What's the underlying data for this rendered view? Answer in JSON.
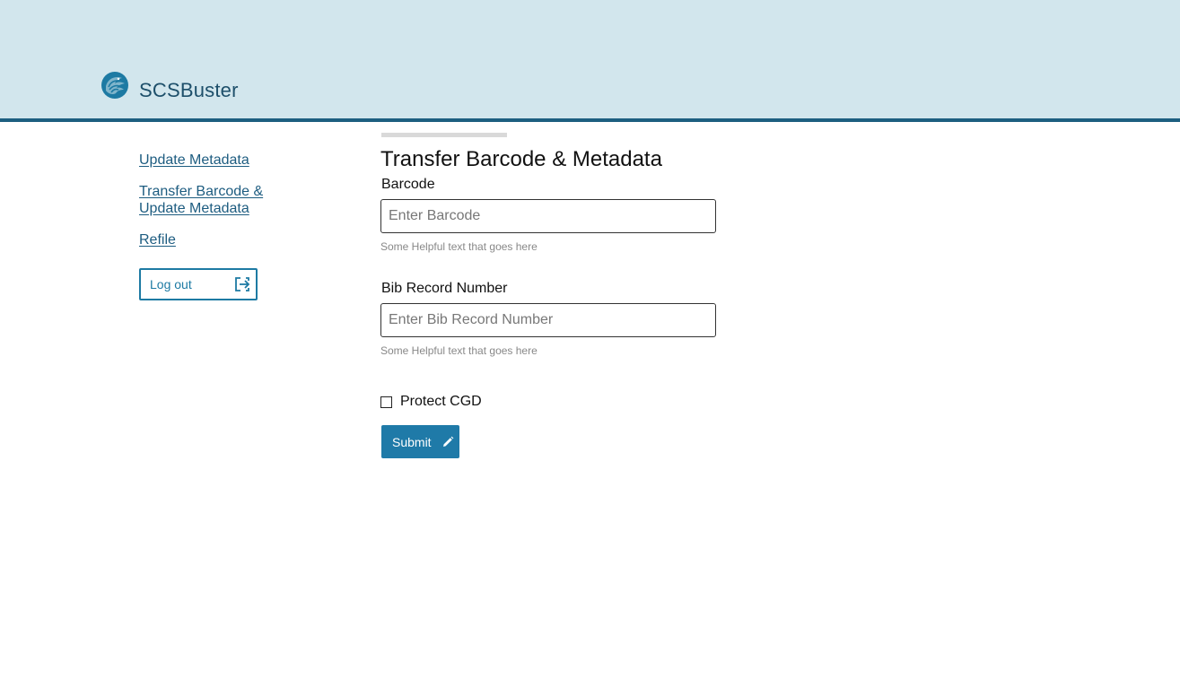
{
  "app": {
    "name": "SCSBuster",
    "logo_icon": "library-lion-icon"
  },
  "colors": {
    "header_bg": "#d2e6ed",
    "header_border": "#1d5f80",
    "link": "#1d5c80",
    "primary": "#1f7aa8"
  },
  "sidebar": {
    "items": [
      {
        "label": "Update Metadata"
      },
      {
        "label": "Transfer Barcode & Update Metadata"
      },
      {
        "label": "Refile"
      }
    ],
    "logout": {
      "label": "Log out",
      "icon": "logout-icon"
    }
  },
  "form": {
    "title": "Transfer Barcode & Metadata",
    "barcode": {
      "label": "Barcode",
      "placeholder": "Enter Barcode",
      "value": "",
      "helper": "Some Helpful text that goes here"
    },
    "bib": {
      "label": "Bib Record Number",
      "placeholder": "Enter Bib Record Number",
      "value": "",
      "helper": "Some Helpful text that goes here"
    },
    "protect_cgd": {
      "label": "Protect CGD",
      "checked": false
    },
    "submit": {
      "label": "Submit",
      "icon": "pencil-icon"
    }
  }
}
